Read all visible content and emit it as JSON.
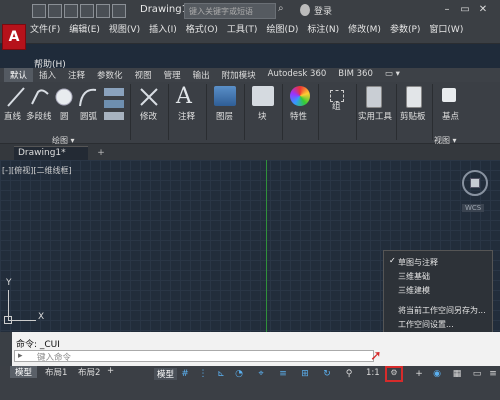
{
  "app": {
    "logo_letter": "A",
    "doc_title": "Drawing1.d...",
    "login": "登录"
  },
  "search": {
    "placeholder": "键入关键字或短语"
  },
  "menu": [
    "文件(F)",
    "编辑(E)",
    "视图(V)",
    "插入(I)",
    "格式(O)",
    "工具(T)",
    "绘图(D)",
    "标注(N)",
    "修改(M)",
    "参数(P)",
    "窗口(W)"
  ],
  "help_menu": "帮助(H)",
  "ribbon_tabs": [
    "默认",
    "插入",
    "注释",
    "参数化",
    "视图",
    "管理",
    "输出",
    "附加模块",
    "Autodesk 360",
    "BIM 360",
    "▭ ▾"
  ],
  "ribbon": {
    "draw": {
      "line": "直线",
      "polyline": "多段线",
      "circle": "圆",
      "arc": "圆弧",
      "footer": "绘图 ▾"
    },
    "modify": "修改",
    "annotate": "注释",
    "layers": "图层",
    "block": "块",
    "properties": "特性",
    "groups": "组",
    "utilities": "实用工具",
    "clipboard": "剪贴板",
    "basepoint": "基点",
    "view_footer": "视图 ▾"
  },
  "doc_tabs": {
    "active": "Drawing1*",
    "add": "+"
  },
  "viewport_label": "[-][俯视][二维线框]",
  "wcs": "WCS",
  "ucs": {
    "x": "X",
    "y": "Y"
  },
  "popup": {
    "items": [
      "草图与注释",
      "三维基础",
      "三维建模",
      "将当前工作空间另存为...",
      "工作空间设置..."
    ],
    "checked_index": 0
  },
  "command": {
    "history": "命令: _CUI",
    "placeholder": "键入命令"
  },
  "layout_tabs": [
    "模型",
    "布局1",
    "布局2",
    "+"
  ],
  "status": {
    "model_button": "模型",
    "scale": "1:1"
  },
  "colors": {
    "canvas": "#222d3b",
    "accent_red": "#d62b2b",
    "logo_red": "#b6121b",
    "green_line": "#2f8f3a"
  }
}
